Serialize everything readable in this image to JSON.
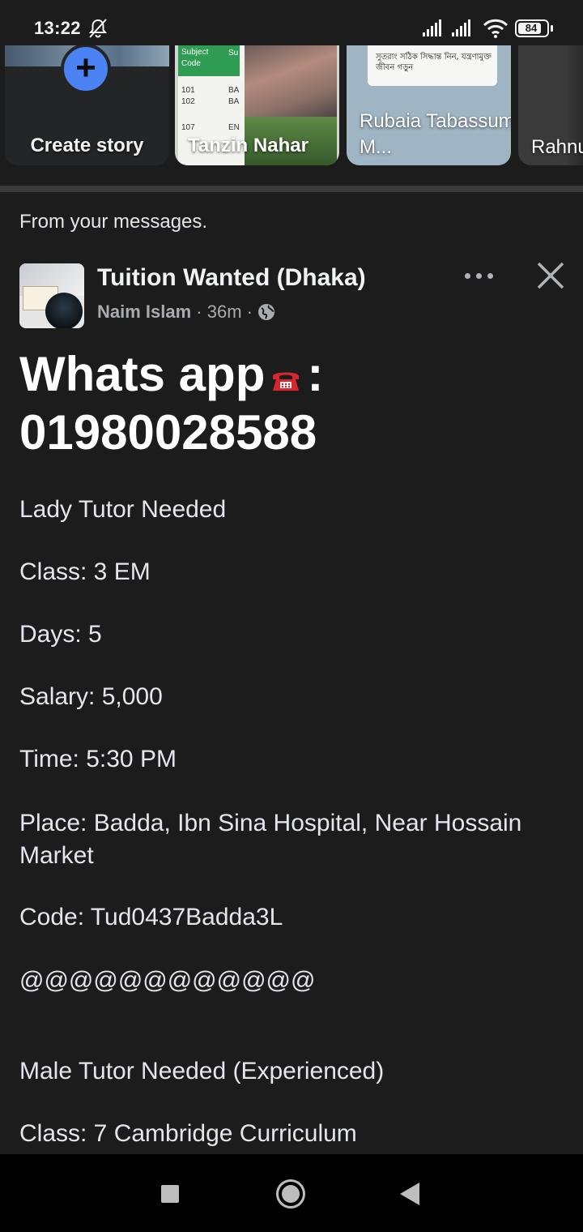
{
  "status_bar": {
    "time": "13:22",
    "battery": "84",
    "icons": [
      "bell-off-icon",
      "signal-icon",
      "signal-icon",
      "wifi-icon",
      "battery-icon"
    ]
  },
  "stories": {
    "create": {
      "label": "Create story",
      "icon": "plus-icon"
    },
    "items": [
      {
        "name": "Tanzin Nahar",
        "preview_text": {
          "header": [
            "Subject",
            "Code"
          ],
          "col2_header": "Su",
          "codes": [
            "101",
            "102",
            "107"
          ],
          "col2": [
            "BA",
            "BA",
            "EN"
          ]
        }
      },
      {
        "name": "Rubaia Tabassum M...",
        "preview_text": "সুতরাং সঠিক সিদ্ধান্ত নিন, যন্ত্রণামুক্ত জীবন গড়ুন"
      },
      {
        "name": "Rahnu Islam"
      }
    ]
  },
  "feed": {
    "section_label": "From your messages.",
    "post": {
      "group_name": "Tuition Wanted (Dhaka)",
      "author": "Naim Islam",
      "time": "36m",
      "separator": "·",
      "headline_prefix": "Whats app",
      "headline_icon": "telephone-icon",
      "headline_suffix": ":",
      "phone": "01980028588",
      "lines": [
        "Lady Tutor Needed",
        "Class: 3 EM",
        "Days: 5",
        "Salary: 5,000",
        "Time: 5:30 PM",
        "Place: Badda, Ibn Sina Hospital, Near Hossain Market",
        "Code: Tud0437Badda3L",
        "@@@@@@@@@@@@",
        "Male Tutor Needed (Experienced)",
        "Class: 7  Cambridge Curriculum"
      ]
    }
  },
  "nav_bar": {
    "icons": [
      "recents-square-icon",
      "home-circle-icon",
      "back-triangle-icon"
    ]
  }
}
